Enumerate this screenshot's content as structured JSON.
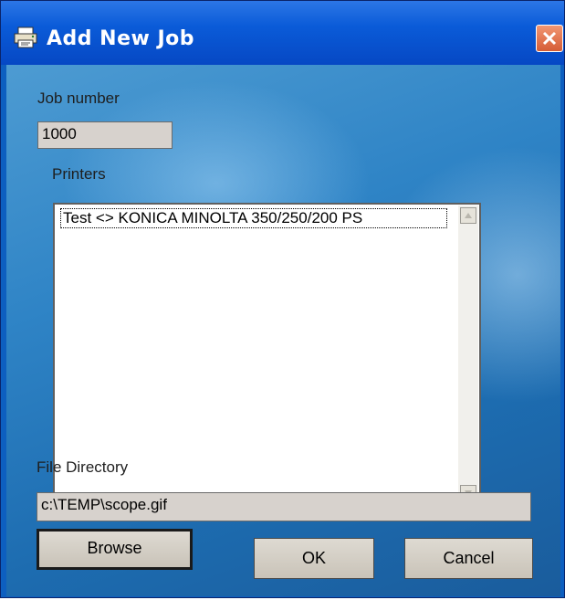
{
  "window": {
    "title": "Add New Job",
    "icon": "printer-icon",
    "close_icon": "close-icon"
  },
  "form": {
    "job_number_label": "Job number",
    "job_number_value": "1000",
    "printers_label": "Printers",
    "printers": [
      "Test <> KONICA MINOLTA 350/250/200 PS"
    ],
    "file_directory_label": "File Directory",
    "file_directory_value": "c:\\TEMP\\scope.gif"
  },
  "buttons": {
    "browse": "Browse",
    "ok": "OK",
    "cancel": "Cancel"
  },
  "colors": {
    "titlebar": "#0a5bd8",
    "close": "#d55d36"
  }
}
